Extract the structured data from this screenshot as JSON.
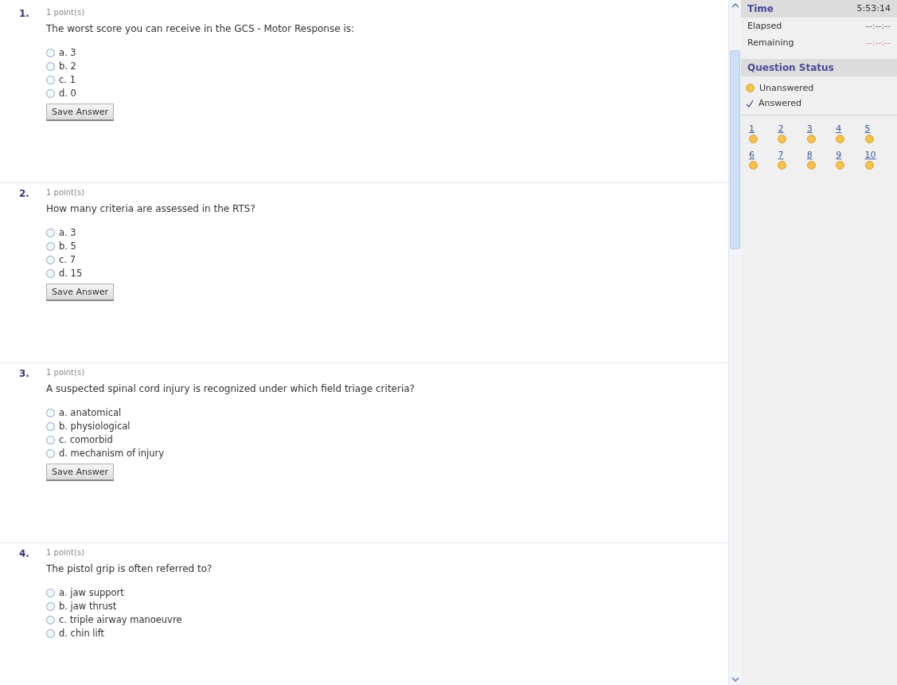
{
  "questions": [
    {
      "number": "1.",
      "points": "1 point(s)",
      "text": "The worst score you can receive in the GCS - Motor Response is:",
      "options": [
        {
          "label": "a. 3",
          "selected": false
        },
        {
          "label": "b. 2",
          "selected": false
        },
        {
          "label": "c. 1",
          "selected": false
        },
        {
          "label": "d. 0",
          "selected": false
        }
      ],
      "button": "Save Answer"
    },
    {
      "number": "2.",
      "points": "1 point(s)",
      "text": "How many criteria are assessed in the RTS?",
      "options": [
        {
          "label": "a. 3",
          "selected": false
        },
        {
          "label": "b. 5",
          "selected": false
        },
        {
          "label": "c. 7",
          "selected": false
        },
        {
          "label": "d. 15",
          "selected": false
        }
      ],
      "button": "Save Answer"
    },
    {
      "number": "3.",
      "points": "1 point(s)",
      "text": "A suspected spinal cord injury is recognized under which field triage criteria?",
      "options": [
        {
          "label": "a. anatomical",
          "selected": false
        },
        {
          "label": "b. physiological",
          "selected": false
        },
        {
          "label": "c. comorbid",
          "selected": false
        },
        {
          "label": "d. mechanism of injury",
          "selected": false
        }
      ],
      "button": "Save Answer"
    },
    {
      "number": "4.",
      "points": "1 point(s)",
      "text": "The pistol grip is often referred to?",
      "options": [
        {
          "label": "a. jaw support",
          "selected": false
        },
        {
          "label": "b. jaw thrust",
          "selected": false
        },
        {
          "label": "c. triple airway manoeuvre",
          "selected": false
        },
        {
          "label": "d. chin lift",
          "selected": false
        }
      ]
    }
  ],
  "time": {
    "title": "Time",
    "value": "5:53:14",
    "rows": [
      {
        "label": "Elapsed",
        "value": "--:--:--",
        "kind": "elapsed"
      },
      {
        "label": "Remaining",
        "value": "--:--:--",
        "kind": "remaining"
      }
    ]
  },
  "status": {
    "title": "Question Status",
    "legend": [
      {
        "label": "Unanswered",
        "answered": false
      },
      {
        "label": "Answered",
        "answered": true
      }
    ],
    "grid": [
      {
        "label": "1",
        "answered": false
      },
      {
        "label": "2",
        "answered": false
      },
      {
        "label": "3",
        "answered": false
      },
      {
        "label": "4",
        "answered": false
      },
      {
        "label": "5",
        "answered": false
      },
      {
        "label": "6",
        "answered": false
      },
      {
        "label": "7",
        "answered": false
      },
      {
        "label": "8",
        "answered": false
      },
      {
        "label": "9",
        "answered": false
      },
      {
        "label": "10",
        "answered": false
      }
    ]
  }
}
